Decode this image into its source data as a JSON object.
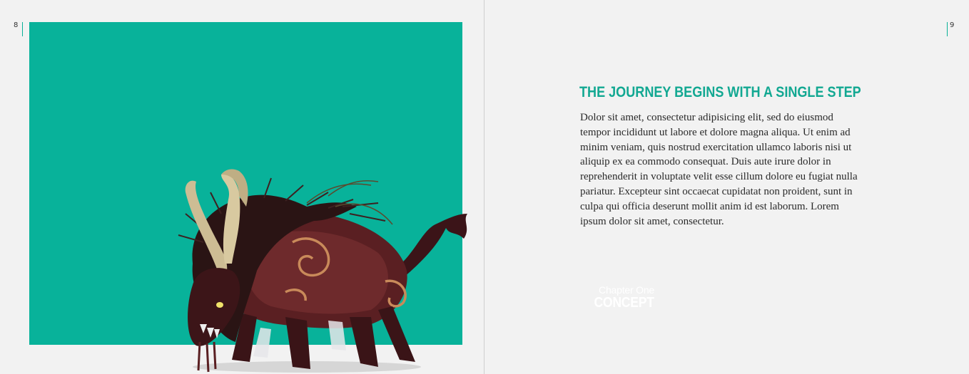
{
  "pages": {
    "left": {
      "number": "8",
      "chapter": {
        "sub": "Chapter One",
        "title": "CONCEPT"
      },
      "colors": {
        "block": "#08b29a"
      }
    },
    "right": {
      "number": "9",
      "heading": "THE JOURNEY BEGINS WITH A SINGLE STEP",
      "body": "Dolor sit amet, consectetur adipisicing elit, sed do eiusmod tempor incididunt ut labore et dolore magna aliqua. Ut enim ad minim veniam, quis nostrud exercitation ullamco laboris nisi ut aliquip ex ea commodo consequat. Duis aute irure dolor in reprehenderit in voluptate velit esse cillum dolore eu fugiat nulla pariatur. Excepteur sint occaecat cupidatat non proident, sunt in culpa qui officia deserunt mollit anim id est laborum. Lorem ipsum dolor sit amet, consectetur.",
      "colors": {
        "heading": "#12a892"
      }
    }
  },
  "illustration": "horned-beast-illustration"
}
